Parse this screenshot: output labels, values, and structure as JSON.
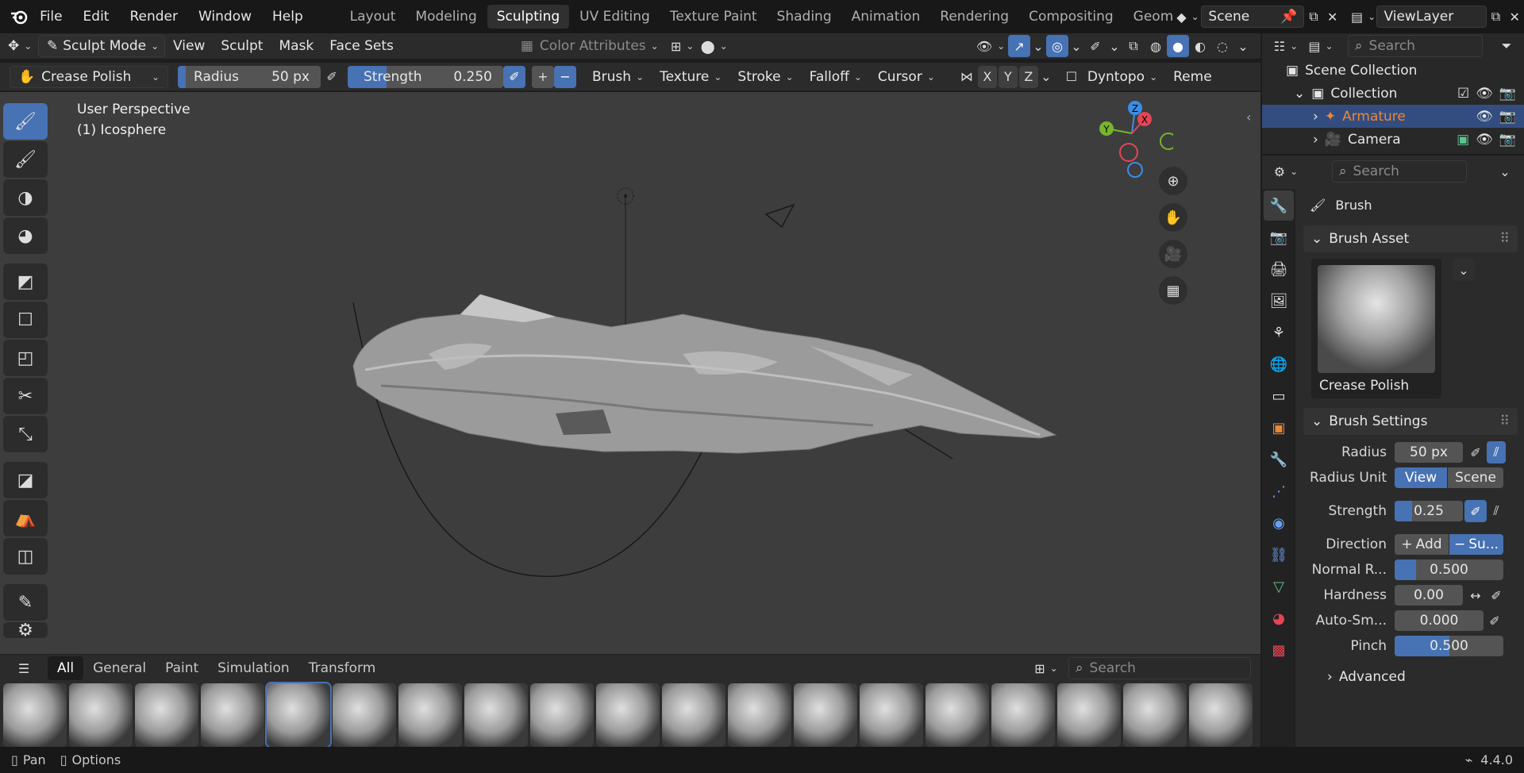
{
  "menu": {
    "items": [
      "File",
      "Edit",
      "Render",
      "Window",
      "Help"
    ],
    "workspaces": [
      "Layout",
      "Modeling",
      "Sculpting",
      "UV Editing",
      "Texture Paint",
      "Shading",
      "Animation",
      "Rendering",
      "Compositing",
      "Geomet"
    ],
    "active_workspace": "Sculpting",
    "scene": "Scene",
    "view_layer": "ViewLayer"
  },
  "header1": {
    "mode": "Sculpt Mode",
    "menus": [
      "View",
      "Sculpt",
      "Mask",
      "Face Sets"
    ],
    "color_attributes": "Color Attributes"
  },
  "header2": {
    "brush": "Crease Polish",
    "radius_label": "Radius",
    "radius_value": "50 px",
    "strength_label": "Strength",
    "strength_value": "0.250",
    "strength_fraction": 0.25,
    "menus": [
      "Brush",
      "Texture",
      "Stroke",
      "Falloff",
      "Cursor"
    ],
    "axes": [
      "X",
      "Y",
      "Z"
    ],
    "dyntopo": "Dyntopo",
    "remesh": "Remes"
  },
  "viewport": {
    "perspective": "User Perspective",
    "object": "(1) Icosphere",
    "gizmo": {
      "z": "Z",
      "x": "X",
      "y": "Y"
    }
  },
  "shelf": {
    "tabs": [
      "All",
      "General",
      "Paint",
      "Simulation",
      "Transform"
    ],
    "active_tab": "All",
    "search_placeholder": "Search",
    "thumb_count": 19,
    "selected_index": 4
  },
  "status": {
    "pan": "Pan",
    "options": "Options",
    "version": "4.4.0"
  },
  "outliner": {
    "search_placeholder": "Search",
    "scene_collection": "Scene Collection",
    "collection": "Collection",
    "items": [
      "Armature",
      "Camera"
    ]
  },
  "properties": {
    "search_placeholder": "Search",
    "context_title": "Brush",
    "brush_asset_panel": "Brush Asset",
    "brush_name": "Crease Polish",
    "brush_settings_panel": "Brush Settings",
    "radius_label": "Radius",
    "radius_value": "50 px",
    "radius_unit_label": "Radius Unit",
    "radius_unit_options": [
      "View",
      "Scene"
    ],
    "strength_label": "Strength",
    "strength_value": "0.25",
    "strength_fraction": 0.25,
    "direction_label": "Direction",
    "direction_add": "Add",
    "direction_sub": "Su...",
    "normal_label": "Normal R...",
    "normal_value": "0.500",
    "normal_fraction": 0.5,
    "hardness_label": "Hardness",
    "hardness_value": "0.00",
    "autosmooth_label": "Auto-Sm...",
    "autosmooth_value": "0.000",
    "pinch_label": "Pinch",
    "pinch_value": "0.500",
    "pinch_fraction": 0.5,
    "advanced_panel": "Advanced"
  },
  "colors": {
    "accent": "#4772b3",
    "armature_text": "#e8883a",
    "background": "#3d3d3d"
  }
}
